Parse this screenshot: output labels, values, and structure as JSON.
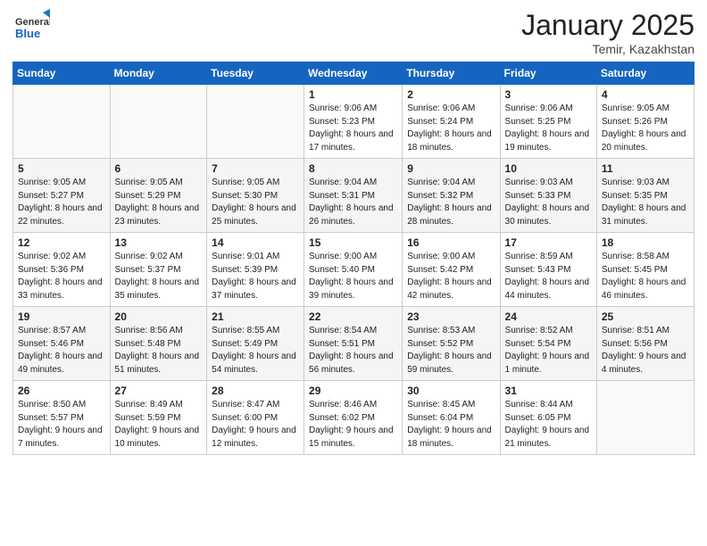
{
  "header": {
    "logo_general": "General",
    "logo_blue": "Blue",
    "month_title": "January 2025",
    "location": "Temir, Kazakhstan"
  },
  "weekdays": [
    "Sunday",
    "Monday",
    "Tuesday",
    "Wednesday",
    "Thursday",
    "Friday",
    "Saturday"
  ],
  "weeks": [
    [
      {
        "day": "",
        "sunrise": "",
        "sunset": "",
        "daylight": ""
      },
      {
        "day": "",
        "sunrise": "",
        "sunset": "",
        "daylight": ""
      },
      {
        "day": "",
        "sunrise": "",
        "sunset": "",
        "daylight": ""
      },
      {
        "day": "1",
        "sunrise": "Sunrise: 9:06 AM",
        "sunset": "Sunset: 5:23 PM",
        "daylight": "Daylight: 8 hours and 17 minutes."
      },
      {
        "day": "2",
        "sunrise": "Sunrise: 9:06 AM",
        "sunset": "Sunset: 5:24 PM",
        "daylight": "Daylight: 8 hours and 18 minutes."
      },
      {
        "day": "3",
        "sunrise": "Sunrise: 9:06 AM",
        "sunset": "Sunset: 5:25 PM",
        "daylight": "Daylight: 8 hours and 19 minutes."
      },
      {
        "day": "4",
        "sunrise": "Sunrise: 9:05 AM",
        "sunset": "Sunset: 5:26 PM",
        "daylight": "Daylight: 8 hours and 20 minutes."
      }
    ],
    [
      {
        "day": "5",
        "sunrise": "Sunrise: 9:05 AM",
        "sunset": "Sunset: 5:27 PM",
        "daylight": "Daylight: 8 hours and 22 minutes."
      },
      {
        "day": "6",
        "sunrise": "Sunrise: 9:05 AM",
        "sunset": "Sunset: 5:29 PM",
        "daylight": "Daylight: 8 hours and 23 minutes."
      },
      {
        "day": "7",
        "sunrise": "Sunrise: 9:05 AM",
        "sunset": "Sunset: 5:30 PM",
        "daylight": "Daylight: 8 hours and 25 minutes."
      },
      {
        "day": "8",
        "sunrise": "Sunrise: 9:04 AM",
        "sunset": "Sunset: 5:31 PM",
        "daylight": "Daylight: 8 hours and 26 minutes."
      },
      {
        "day": "9",
        "sunrise": "Sunrise: 9:04 AM",
        "sunset": "Sunset: 5:32 PM",
        "daylight": "Daylight: 8 hours and 28 minutes."
      },
      {
        "day": "10",
        "sunrise": "Sunrise: 9:03 AM",
        "sunset": "Sunset: 5:33 PM",
        "daylight": "Daylight: 8 hours and 30 minutes."
      },
      {
        "day": "11",
        "sunrise": "Sunrise: 9:03 AM",
        "sunset": "Sunset: 5:35 PM",
        "daylight": "Daylight: 8 hours and 31 minutes."
      }
    ],
    [
      {
        "day": "12",
        "sunrise": "Sunrise: 9:02 AM",
        "sunset": "Sunset: 5:36 PM",
        "daylight": "Daylight: 8 hours and 33 minutes."
      },
      {
        "day": "13",
        "sunrise": "Sunrise: 9:02 AM",
        "sunset": "Sunset: 5:37 PM",
        "daylight": "Daylight: 8 hours and 35 minutes."
      },
      {
        "day": "14",
        "sunrise": "Sunrise: 9:01 AM",
        "sunset": "Sunset: 5:39 PM",
        "daylight": "Daylight: 8 hours and 37 minutes."
      },
      {
        "day": "15",
        "sunrise": "Sunrise: 9:00 AM",
        "sunset": "Sunset: 5:40 PM",
        "daylight": "Daylight: 8 hours and 39 minutes."
      },
      {
        "day": "16",
        "sunrise": "Sunrise: 9:00 AM",
        "sunset": "Sunset: 5:42 PM",
        "daylight": "Daylight: 8 hours and 42 minutes."
      },
      {
        "day": "17",
        "sunrise": "Sunrise: 8:59 AM",
        "sunset": "Sunset: 5:43 PM",
        "daylight": "Daylight: 8 hours and 44 minutes."
      },
      {
        "day": "18",
        "sunrise": "Sunrise: 8:58 AM",
        "sunset": "Sunset: 5:45 PM",
        "daylight": "Daylight: 8 hours and 46 minutes."
      }
    ],
    [
      {
        "day": "19",
        "sunrise": "Sunrise: 8:57 AM",
        "sunset": "Sunset: 5:46 PM",
        "daylight": "Daylight: 8 hours and 49 minutes."
      },
      {
        "day": "20",
        "sunrise": "Sunrise: 8:56 AM",
        "sunset": "Sunset: 5:48 PM",
        "daylight": "Daylight: 8 hours and 51 minutes."
      },
      {
        "day": "21",
        "sunrise": "Sunrise: 8:55 AM",
        "sunset": "Sunset: 5:49 PM",
        "daylight": "Daylight: 8 hours and 54 minutes."
      },
      {
        "day": "22",
        "sunrise": "Sunrise: 8:54 AM",
        "sunset": "Sunset: 5:51 PM",
        "daylight": "Daylight: 8 hours and 56 minutes."
      },
      {
        "day": "23",
        "sunrise": "Sunrise: 8:53 AM",
        "sunset": "Sunset: 5:52 PM",
        "daylight": "Daylight: 8 hours and 59 minutes."
      },
      {
        "day": "24",
        "sunrise": "Sunrise: 8:52 AM",
        "sunset": "Sunset: 5:54 PM",
        "daylight": "Daylight: 9 hours and 1 minute."
      },
      {
        "day": "25",
        "sunrise": "Sunrise: 8:51 AM",
        "sunset": "Sunset: 5:56 PM",
        "daylight": "Daylight: 9 hours and 4 minutes."
      }
    ],
    [
      {
        "day": "26",
        "sunrise": "Sunrise: 8:50 AM",
        "sunset": "Sunset: 5:57 PM",
        "daylight": "Daylight: 9 hours and 7 minutes."
      },
      {
        "day": "27",
        "sunrise": "Sunrise: 8:49 AM",
        "sunset": "Sunset: 5:59 PM",
        "daylight": "Daylight: 9 hours and 10 minutes."
      },
      {
        "day": "28",
        "sunrise": "Sunrise: 8:47 AM",
        "sunset": "Sunset: 6:00 PM",
        "daylight": "Daylight: 9 hours and 12 minutes."
      },
      {
        "day": "29",
        "sunrise": "Sunrise: 8:46 AM",
        "sunset": "Sunset: 6:02 PM",
        "daylight": "Daylight: 9 hours and 15 minutes."
      },
      {
        "day": "30",
        "sunrise": "Sunrise: 8:45 AM",
        "sunset": "Sunset: 6:04 PM",
        "daylight": "Daylight: 9 hours and 18 minutes."
      },
      {
        "day": "31",
        "sunrise": "Sunrise: 8:44 AM",
        "sunset": "Sunset: 6:05 PM",
        "daylight": "Daylight: 9 hours and 21 minutes."
      },
      {
        "day": "",
        "sunrise": "",
        "sunset": "",
        "daylight": ""
      }
    ]
  ]
}
